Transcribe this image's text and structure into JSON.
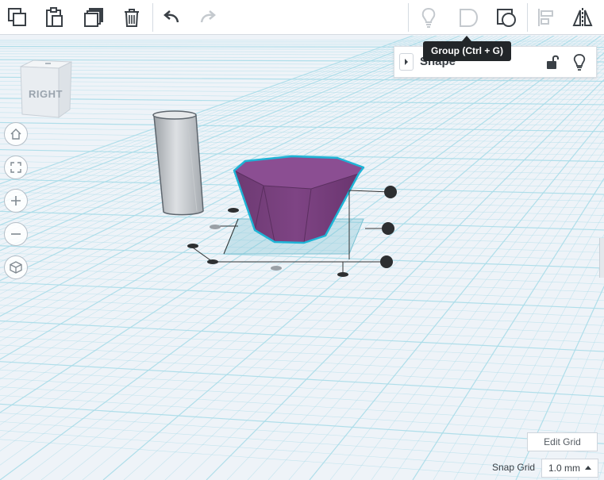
{
  "toolbar": {
    "buttons": [
      {
        "name": "copy-icon"
      },
      {
        "name": "paste-icon"
      },
      {
        "name": "duplicate-icon"
      },
      {
        "name": "delete-icon"
      },
      {
        "name": "undo-icon"
      },
      {
        "name": "redo-icon"
      },
      {
        "name": "bulb-icon"
      },
      {
        "name": "group-icon"
      },
      {
        "name": "ungroup-icon"
      },
      {
        "name": "align-icon"
      },
      {
        "name": "mirror-icon"
      }
    ]
  },
  "tooltip": {
    "text": "Group (Ctrl + G)"
  },
  "shape_panel": {
    "title": "Shape"
  },
  "viewcube": {
    "label": "RIGHT"
  },
  "nav": [
    "home-icon",
    "fit-view-icon",
    "zoom-in-icon",
    "zoom-out-icon",
    "perspective-icon"
  ],
  "grid_controls": {
    "edit_grid_label": "Edit Grid",
    "snap_label": "Snap Grid",
    "snap_value": "1.0 mm"
  },
  "colors": {
    "selection": "#1fb4d6",
    "shape_fill": "#8a4a8e",
    "grid_line": "#a7dbe8",
    "background": "#eef3f8"
  }
}
